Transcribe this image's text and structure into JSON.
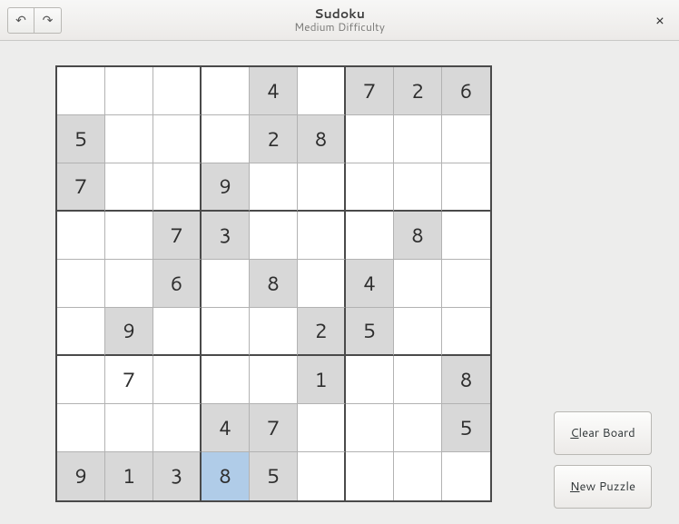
{
  "header": {
    "title": "Sudoku",
    "subtitle": "Medium Difficulty",
    "undo_label": "↶",
    "redo_label": "↷",
    "close_label": "×"
  },
  "buttons": {
    "clear_prefix": "C",
    "clear_rest": "lear Board",
    "new_prefix": "N",
    "new_rest": "ew Puzzle"
  },
  "selected": [
    8,
    3
  ],
  "board": [
    [
      "",
      "",
      "",
      "",
      "4g",
      "",
      "7g",
      "2g",
      "6g"
    ],
    [
      "5g",
      "",
      "",
      "",
      "2g",
      "8g",
      "",
      "",
      ""
    ],
    [
      "7g",
      "",
      "",
      "9g",
      "",
      "",
      "",
      "",
      ""
    ],
    [
      "",
      "",
      "7g",
      "3g",
      "",
      "",
      "",
      "8g",
      ""
    ],
    [
      "",
      "",
      "6g",
      "",
      "8g",
      "",
      "4g",
      "",
      ""
    ],
    [
      "",
      "9g",
      "",
      "",
      "",
      "2g",
      "5g",
      "",
      ""
    ],
    [
      "",
      "7u",
      "",
      "",
      "",
      "1g",
      "",
      "",
      "8g"
    ],
    [
      "",
      "",
      "",
      "4g",
      "7g",
      "",
      "",
      "",
      "5g"
    ],
    [
      "9g",
      "1g",
      "3g",
      "8g",
      "5g",
      "",
      "",
      "",
      ""
    ]
  ]
}
